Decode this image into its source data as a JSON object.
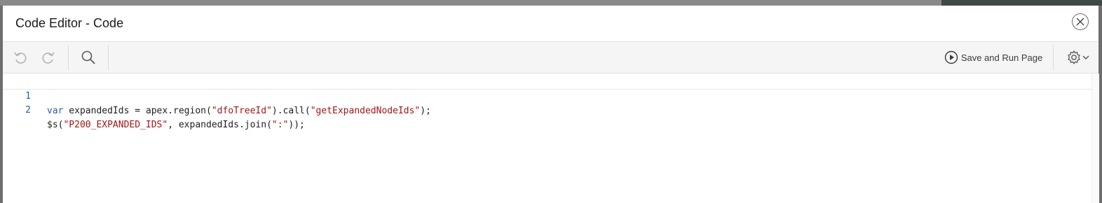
{
  "dialog": {
    "title": "Code Editor - Code",
    "close_icon": "close-icon"
  },
  "toolbar": {
    "undo_icon": "undo-icon",
    "redo_icon": "redo-icon",
    "search_icon": "search-icon",
    "save_run_label": "Save and Run Page",
    "play_icon": "play-circle-icon",
    "settings_icon": "gear-icon",
    "chevron_icon": "chevron-down-icon"
  },
  "editor": {
    "lines": [
      {
        "number": "1",
        "tokens": {
          "t1": "var",
          "t2": " expandedIds = apex.region(",
          "t3": "\"dfoTreeId\"",
          "t4": ").call(",
          "t5": "\"getExpandedNodeIds\"",
          "t6": ");"
        }
      },
      {
        "number": "2",
        "tokens": {
          "t1": "$s(",
          "t2": "\"P200_EXPANDED_IDS\"",
          "t3": ", expandedIds.join(",
          "t4": "\":\"",
          "t5": "));"
        }
      }
    ]
  },
  "colors": {
    "keyword": "#2a5db0",
    "string": "#a31515",
    "line_number": "#1d5f9e"
  }
}
